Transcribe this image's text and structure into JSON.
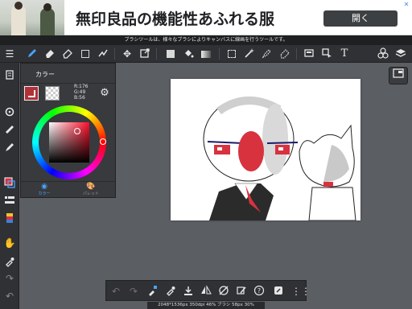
{
  "ad": {
    "title": "無印良品の機能性あふれる服",
    "open_label": "開く",
    "close_glyph": "✕"
  },
  "tip": {
    "text": "ブラシツールは、様々なブラシによりキャンバスに線画を行うツールです。"
  },
  "toolbar": {
    "active_tool": "brush",
    "icons": [
      "menu-icon",
      "brush-icon",
      "eraser-icon",
      "blur-eraser-icon",
      "rectangle-icon",
      "gradient-dots-icon",
      "move-icon",
      "transform-icon",
      "fill-square-icon",
      "bucket-icon",
      "gradient-icon",
      "select-dashed-icon",
      "magic-wand-icon",
      "lasso-icon",
      "select-pen-icon",
      "layout-icon",
      "select-move-icon",
      "text-icon",
      "materials-icon",
      "layers-icon"
    ]
  },
  "sidebar": {
    "icons": [
      "pages-icon",
      "selection-icon",
      "rotate-icon",
      "ruler-icon",
      "brush-size-icon",
      "color-icon",
      "layer-list-icon",
      "palette-icon",
      "hand-icon",
      "eyedropper-icon",
      "redo-icon",
      "undo-icon"
    ]
  },
  "color_panel": {
    "title": "カラー",
    "main_color": "#b03138",
    "rgb": {
      "r": "R:176",
      "g": "G:49",
      "b": "B:56"
    },
    "tabs": [
      {
        "label": "カラー",
        "icon": "color-wheel-icon",
        "active": true
      },
      {
        "label": "パレット",
        "icon": "palette-icon",
        "active": false
      }
    ]
  },
  "canvas": {
    "background": "#ffffff",
    "accent_red": "#d8323f"
  },
  "bottombar": {
    "icons": [
      "undo-icon",
      "redo-icon",
      "eyedropper-fill-icon",
      "eyedropper-icon",
      "download-icon",
      "flip-icon",
      "no-snap-icon",
      "crop-pen-icon",
      "help-icon",
      "share-icon",
      "grid-dots-icon"
    ]
  },
  "status": {
    "text": "2048*1536px 350dpi 46% ブラシ 58px 30%"
  }
}
